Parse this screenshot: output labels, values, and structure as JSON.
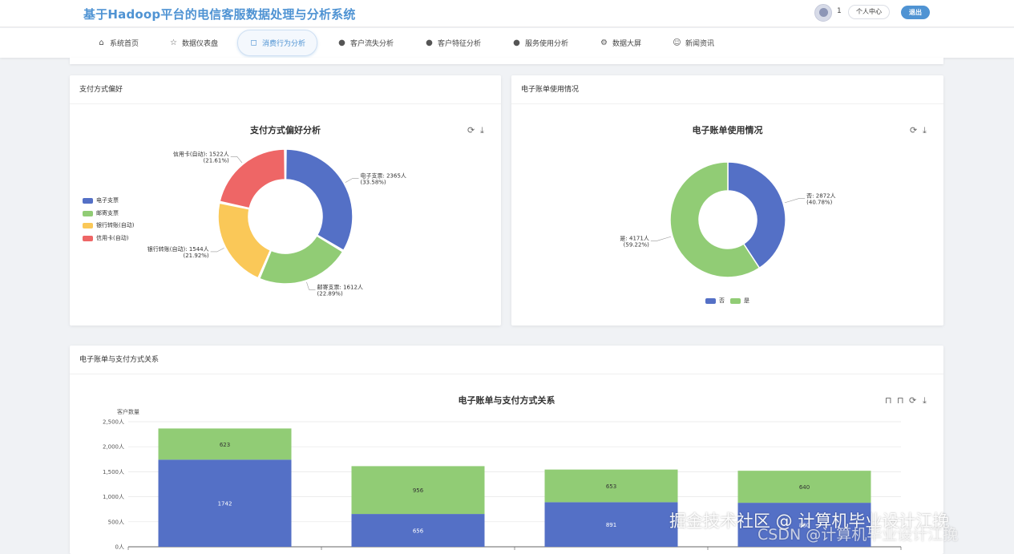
{
  "header": {
    "title": "基于Hadoop平台的电信客服数据处理与分析系统",
    "user_count": "1",
    "profile_label": "个人中心",
    "logout_label": "退出"
  },
  "nav": {
    "items": [
      {
        "label": "系统首页",
        "icon": "home-icon"
      },
      {
        "label": "数据仪表盘",
        "icon": "star-icon"
      },
      {
        "label": "消费行为分析",
        "icon": "bag-icon"
      },
      {
        "label": "客户流失分析",
        "icon": "alert-icon"
      },
      {
        "label": "客户特征分析",
        "icon": "question-icon"
      },
      {
        "label": "服务使用分析",
        "icon": "info-icon"
      },
      {
        "label": "数据大屏",
        "icon": "gear-icon"
      },
      {
        "label": "新闻资讯",
        "icon": "smile-icon"
      }
    ],
    "active_index": 2
  },
  "cards": {
    "payment": {
      "header": "支付方式偏好"
    },
    "ebill": {
      "header": "电子账单使用情况"
    },
    "relation": {
      "header": "电子账单与支付方式关系"
    }
  },
  "toolbar_icons": [
    "refresh-icon",
    "download-icon",
    "line-chart-icon",
    "bar-chart-icon"
  ],
  "watermark": {
    "line1": "掘金技术社区 @ 计算机毕业设计江挽",
    "line2": "CSDN @计算机毕业设计江挽"
  },
  "colors": {
    "accent": "#4f93d3",
    "blue": "#5470c6",
    "green": "#91cc75",
    "yellow": "#fac858",
    "red": "#ee6666"
  },
  "chart_data": [
    {
      "type": "pie",
      "title": "支付方式偏好分析",
      "unit": "人",
      "slices": [
        {
          "name": "电子支票",
          "value": 2365,
          "percent": "33.58%"
        },
        {
          "name": "邮寄支票",
          "value": 1612,
          "percent": "22.89%"
        },
        {
          "name": "银行转账(自动)",
          "value": 1544,
          "percent": "21.92%"
        },
        {
          "name": "信用卡(自动)",
          "value": 1522,
          "percent": "21.61%"
        }
      ],
      "legend_position": "left"
    },
    {
      "type": "pie",
      "title": "电子账单使用情况",
      "unit": "人",
      "slices": [
        {
          "name": "否",
          "value": 2872,
          "percent": "40.78%"
        },
        {
          "name": "是",
          "value": 4171,
          "percent": "59.22%"
        }
      ],
      "legend_position": "bottom"
    },
    {
      "type": "bar",
      "title": "电子账单与支付方式关系",
      "ylabel": "客户数量",
      "yticks": [
        "2,500人",
        "2,000人",
        "1,500人",
        "1,000人",
        "500人",
        "0人"
      ],
      "ylim": [
        0,
        2500
      ],
      "stacked": true,
      "categories": [
        "",
        "",
        "",
        ""
      ],
      "series": [
        {
          "values": [
            1742,
            656,
            891,
            880
          ]
        },
        {
          "values": [
            623,
            956,
            653,
            640
          ]
        }
      ]
    }
  ]
}
